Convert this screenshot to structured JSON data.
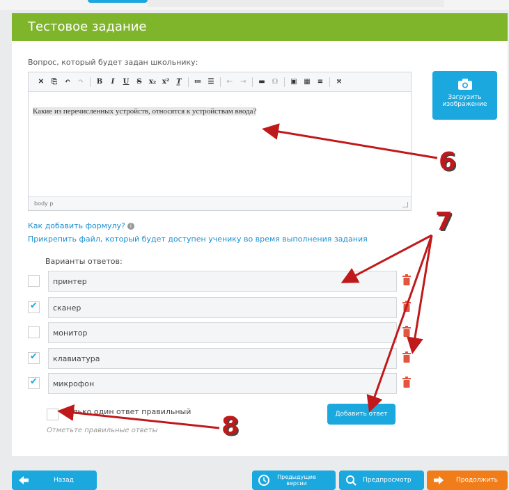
{
  "page": {
    "title": "Тестовое задание",
    "question_label": "Вопрос, который будет задан школьнику:",
    "question_text": "Какие из перечисленных устройств, относятся к устройствам ввода?",
    "editor_footer": "body  p",
    "upload_label": "Загрузить изображение",
    "formula_link": "Как добавить формулу?",
    "attach_link": "Прикрепить файл, который будет доступен ученику во время выполнения задания",
    "answers_label": "Варианты ответов:",
    "answers": [
      {
        "text": "принтер",
        "checked": false
      },
      {
        "text": "сканер",
        "checked": true
      },
      {
        "text": "монитор",
        "checked": false
      },
      {
        "text": "клавиатура",
        "checked": true
      },
      {
        "text": "микрофон",
        "checked": true
      }
    ],
    "only_one_label": "Только один ответ правильный",
    "hint": "Отметьте правильные ответы",
    "add_answer": "Добавить ответ"
  },
  "toolbar_icons": [
    "cut-icon",
    "copy-icon",
    "undo-icon",
    "redo-icon",
    "bold-icon",
    "italic-icon",
    "underline-icon",
    "strikethrough-icon",
    "subscript-icon",
    "superscript-icon",
    "remove-format-icon",
    "numbered-list-icon",
    "bulleted-list-icon",
    "outdent-icon",
    "indent-icon",
    "horizontal-line-icon",
    "special-char-icon",
    "image-icon",
    "table-icon",
    "page-break-icon",
    "maximize-icon"
  ],
  "bottom": {
    "back": "Назад",
    "previous_versions": "Предыдущие версии",
    "preview": "Предпросмотр",
    "continue": "Продолжить"
  },
  "annotations": [
    "6",
    "7",
    "8"
  ],
  "colors": {
    "header_green": "#7fb52b",
    "accent_blue": "#1ba8df",
    "continue_orange": "#f07d1a",
    "trash_red": "#e2553f",
    "annotation_red": "#c0191b"
  }
}
